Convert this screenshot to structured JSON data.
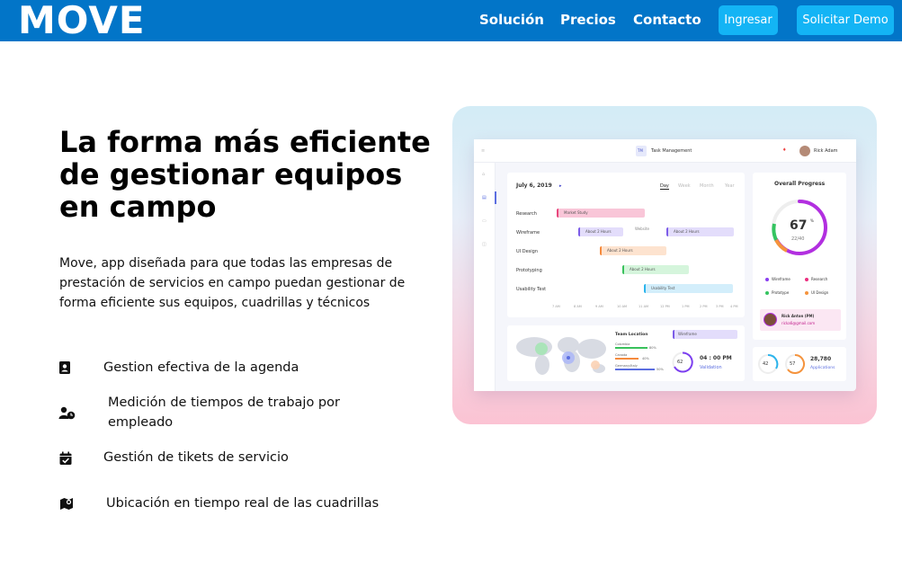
{
  "nav": {
    "logo": "MOVE",
    "links": [
      "Solución",
      "Precios",
      "Contacto"
    ],
    "login_button": "Ingresar",
    "demo_button": "Solicitar Demo"
  },
  "hero": {
    "title": "La forma más eficiente de gestionar equipos en campo",
    "description": "Move, app diseñada para que todas las empresas de prestación de servicios en campo puedan gestionar de forma eficiente sus equipos, cuadrillas y técnicos"
  },
  "features": [
    {
      "icon": "contact-card-icon",
      "text": "Gestion efectiva de la agenda"
    },
    {
      "icon": "user-clock-icon",
      "text": "Medición de tiempos de trabajo por empleado"
    },
    {
      "icon": "calendar-check-icon",
      "text": "Gestión de tikets de servicio"
    },
    {
      "icon": "map-marker-icon",
      "text": "Ubicación en tiempo real de las cuadrillas"
    }
  ],
  "dashboard": {
    "app_title": "Task Management",
    "app_badge": "TM",
    "user": "Rick Adam",
    "date": "July 6, 2019",
    "views": [
      "Day",
      "Week",
      "Month",
      "Year"
    ],
    "gantt_rows": [
      "Research",
      "Wireframe",
      "UI Design",
      "Prototyping",
      "Usability Test"
    ],
    "gantt_bars": [
      {
        "label": "Market Study",
        "color": "#f9c6d8",
        "border": "#e8467c"
      },
      {
        "label": "About 2 Hours",
        "color": "#e3ddfb",
        "border": "#7c5ce8"
      },
      {
        "label": "About 2 Hours",
        "color": "#e3ddfb",
        "border": "#7c5ce8"
      },
      {
        "label": "About 2 Hours",
        "color": "#fde3cf",
        "border": "#f58a3c"
      },
      {
        "label": "About 2 Hours",
        "color": "#d5f5dc",
        "border": "#39c15c"
      },
      {
        "label": "Usability Test",
        "color": "#d3eefb",
        "border": "#2cb4ec"
      }
    ],
    "gantt_mid_label": "Website",
    "time_axis": [
      "7 AM",
      "8 AM",
      "9 AM",
      "10 AM",
      "11 AM",
      "12 PM",
      "1 PM",
      "2 PM",
      "3 PM",
      "4 PM"
    ],
    "progress_title": "Overall Progress",
    "progress_percent": "67",
    "progress_pct_sign": "%",
    "progress_fraction": "22/40",
    "progress_value": 0.67,
    "progress_legend": [
      "Wireframe",
      "Research",
      "Prototype",
      "UI Design"
    ],
    "progress_legend_colors": [
      "#8a3ff0",
      "#ec2f7f",
      "#34c460",
      "#f5933c"
    ],
    "pm_name": "Rick Anton (PM)",
    "pm_email": "ricka6@gmail.com",
    "team_location": "Team Location",
    "loc_labels": [
      "Colombia",
      "Canada",
      "Germany/Italy"
    ],
    "loc_values": [
      "80%",
      "40%",
      "50%"
    ],
    "wireframe_tag": "Wireframe",
    "clock_percent": "62",
    "clock_time": "04 : 00 PM",
    "clock_label": "Validation",
    "small_gauge_1": "42",
    "small_gauge_2": "57",
    "applications_count": "28,780",
    "applications_label": "Applications"
  }
}
